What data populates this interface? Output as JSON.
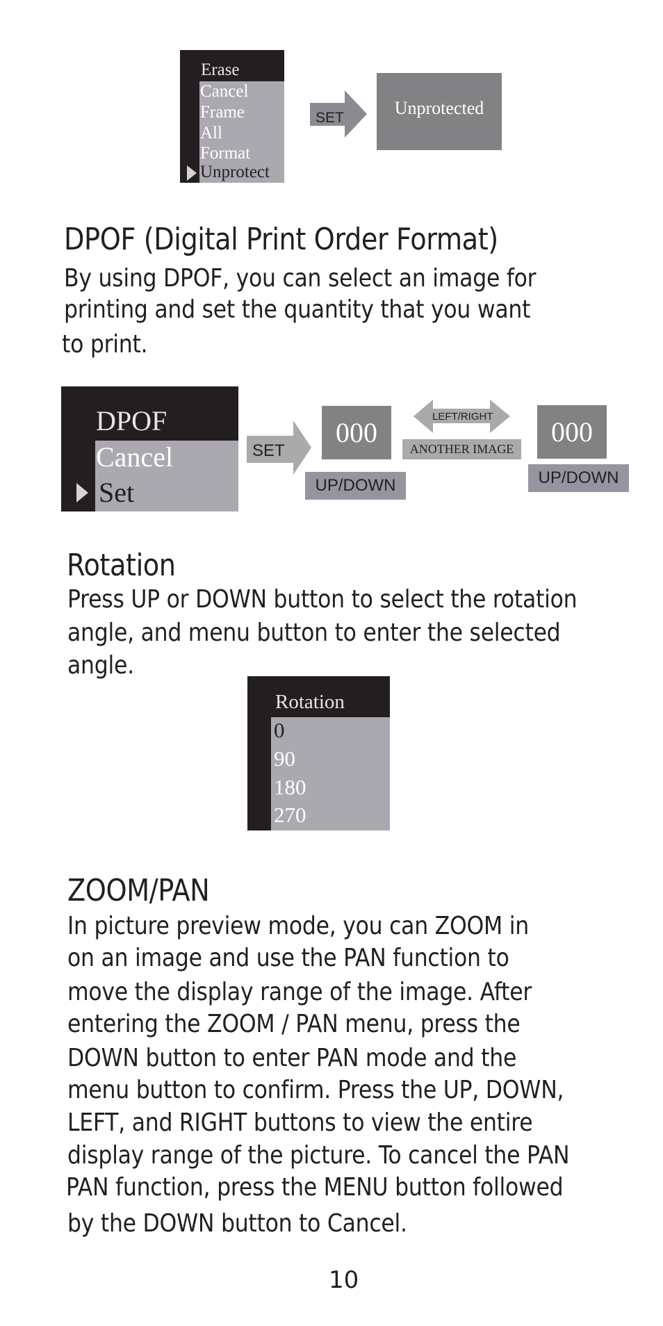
{
  "erase_diagram": {
    "menu_title": "Erase",
    "options": [
      "Cancel",
      "Frame",
      "All",
      "Format",
      "Unprotect"
    ],
    "selected_index": 4,
    "set_label": "SET",
    "result_label": "Unprotected"
  },
  "dpof": {
    "heading": "DPOF (Digital Print Order Format)",
    "lines": [
      "By using DPOF, you can select an image for",
      "printing and set the quantity that you want",
      "to print."
    ],
    "diagram": {
      "menu_title": "DPOF",
      "options": [
        "Cancel",
        "Set"
      ],
      "selected_index": 1,
      "set_label": "SET",
      "quantity_left": "000",
      "updown_left": "UP/DOWN",
      "leftright_label": "LEFT/RIGHT",
      "another_image_label": "ANOTHER IMAGE",
      "quantity_right": "000",
      "updown_right": "UP/DOWN"
    }
  },
  "rotation": {
    "heading": "Rotation",
    "lines": [
      "Press UP or DOWN button to select the rotation",
      "angle, and menu button to enter the selected",
      "angle."
    ],
    "diagram": {
      "menu_title": "Rotation",
      "options": [
        "0",
        "90",
        "180",
        "270"
      ],
      "selected_index": 0
    }
  },
  "zoom_pan": {
    "heading": "ZOOM/PAN",
    "lines": [
      "In picture preview mode, you can ZOOM in",
      "on an image and use the PAN function to",
      "move the display range of the image.  After",
      "entering the ZOOM / PAN menu, press the",
      "DOWN button to enter PAN mode and the",
      "menu button to confirm.  Press the UP, DOWN,",
      "LEFT, and RIGHT buttons to view the entire",
      "display range of the picture.  To cancel the PAN",
      "PAN function, press the MENU button followed",
      "by the DOWN button to Cancel."
    ]
  },
  "page_number": "10",
  "colors": {
    "menu_dark": "#231f20",
    "menu_gray": "#aba9b0",
    "box_dark": "#828284",
    "arrow_gray": "#aaaaaa",
    "tag_gray": "#96959f"
  }
}
